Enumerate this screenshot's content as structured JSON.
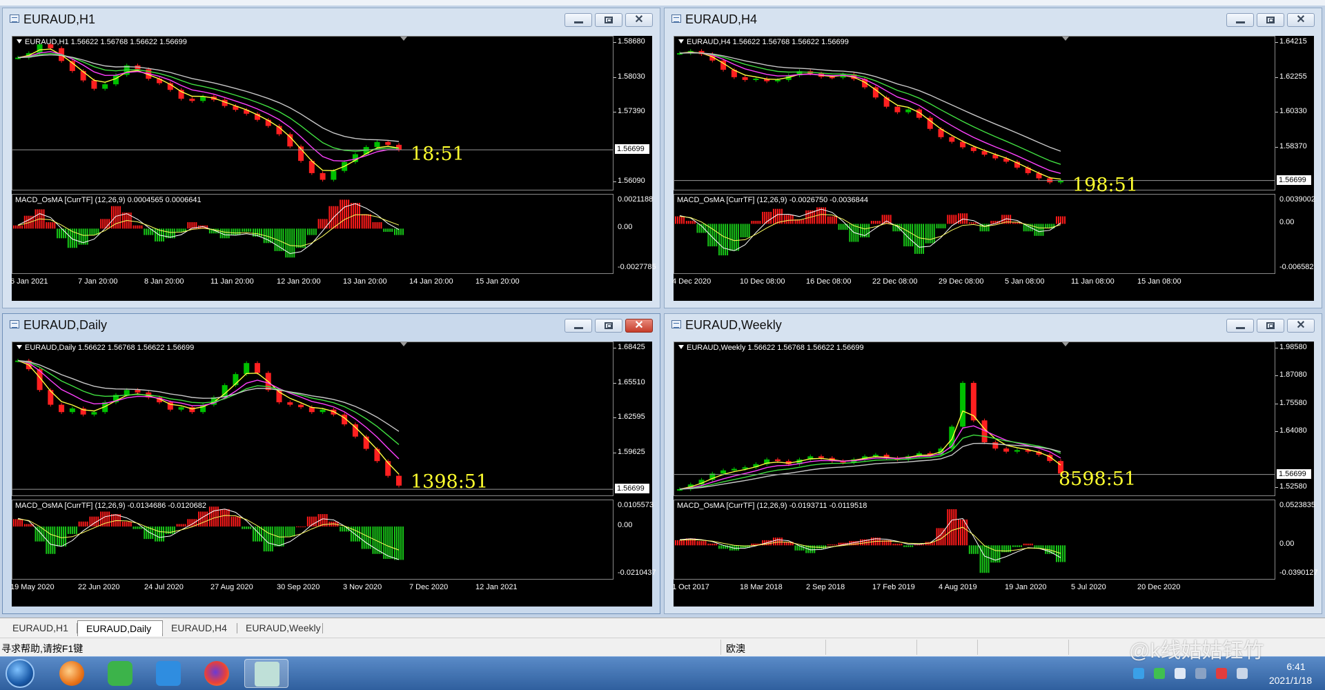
{
  "windows": [
    {
      "id": "h1",
      "title": "EURAUD,H1",
      "active": false,
      "close_red": false,
      "header": "EURAUD,H1  1.56622 1.56768 1.56622 1.56699",
      "macd_header": "MACD_OsMA [CurrTF] (12,26,9) 0.0004565 0.0006641",
      "price_axis": [
        "1.58680",
        "1.58030",
        "1.57390",
        "1.56699",
        "1.56090"
      ],
      "current_price": "1.56699",
      "macd_axis": [
        "0.0021188",
        "0.00",
        "-0.0027785"
      ],
      "timer": "18:51",
      "x_labels": [
        "6 Jan 2021",
        "7 Jan 20:00",
        "8 Jan 20:00",
        "11 Jan 20:00",
        "12 Jan 20:00",
        "13 Jan 20:00",
        "14 Jan 20:00",
        "15 Jan 20:00"
      ],
      "series": [
        1.5836,
        1.5844,
        1.586,
        1.5853,
        1.583,
        1.5812,
        1.5795,
        1.578,
        1.5788,
        1.5805,
        1.5822,
        1.5815,
        1.5798,
        1.579,
        1.5778,
        1.5762,
        1.5758,
        1.5766,
        1.576,
        1.5749,
        1.5742,
        1.5735,
        1.5724,
        1.5713,
        1.5698,
        1.5676,
        1.565,
        1.5628,
        1.5616,
        1.5632,
        1.5648,
        1.5662,
        1.5675,
        1.5684,
        1.5679,
        1.567
      ],
      "osc": [
        0.0002,
        0.0008,
        0.0012,
        0.0004,
        -0.0006,
        -0.0012,
        -0.001,
        -0.0004,
        0.0006,
        0.0014,
        0.001,
        0.0002,
        -0.0004,
        -0.0008,
        -0.0006,
        -0.0002,
        0.0004,
        0.0002,
        -0.0003,
        -0.0006,
        -0.0004,
        -0.0002,
        -0.0005,
        -0.0009,
        -0.0014,
        -0.0018,
        -0.0012,
        -0.0004,
        0.0006,
        0.0014,
        0.0018,
        0.0016,
        0.0009,
        0.0004,
        -0.0002,
        -0.0004
      ],
      "y_range": [
        1.5598,
        1.5874
      ],
      "osc_range": [
        -0.0027785,
        0.0021188
      ]
    },
    {
      "id": "h4",
      "title": "EURAUD,H4",
      "active": false,
      "close_red": false,
      "header": "EURAUD,H4  1.56622 1.56768 1.56622 1.56699",
      "macd_header": "MACD_OsMA [CurrTF] (12,26,9) -0.0026750 -0.0036844",
      "price_axis": [
        "1.64215",
        "1.62255",
        "1.60330",
        "1.58370",
        "1.56699"
      ],
      "current_price": "1.56699",
      "macd_axis": [
        "0.0039002",
        "0.00",
        "-0.006582"
      ],
      "timer": "198:51",
      "x_labels": [
        "4 Dec 2020",
        "10 Dec 08:00",
        "16 Dec 08:00",
        "22 Dec 08:00",
        "29 Dec 08:00",
        "5 Jan 08:00",
        "11 Jan 08:00",
        "15 Jan 08:00"
      ],
      "series": [
        1.636,
        1.6372,
        1.6355,
        1.632,
        1.627,
        1.623,
        1.6215,
        1.6222,
        1.6208,
        1.6215,
        1.624,
        1.6262,
        1.625,
        1.6232,
        1.6228,
        1.6245,
        1.622,
        1.6175,
        1.612,
        1.607,
        1.604,
        1.6055,
        1.601,
        1.595,
        1.5905,
        1.588,
        1.585,
        1.583,
        1.581,
        1.579,
        1.5772,
        1.574,
        1.571,
        1.5682,
        1.566,
        1.567
      ],
      "osc": [
        0.001,
        0.0004,
        -0.0012,
        -0.003,
        -0.0042,
        -0.0036,
        -0.0018,
        0.0004,
        0.0016,
        0.002,
        0.0012,
        0.0006,
        0.0018,
        0.0022,
        0.001,
        -0.0008,
        -0.0024,
        -0.0018,
        0.0004,
        0.0012,
        -0.001,
        -0.003,
        -0.004,
        -0.0026,
        -0.0006,
        0.0012,
        0.0014,
        0.0002,
        -0.001,
        0.0004,
        0.0012,
        0.0002,
        -0.001,
        -0.0016,
        -0.0006,
        0.001
      ],
      "y_range": [
        1.562,
        1.645
      ],
      "osc_range": [
        -0.006582,
        0.0039002
      ]
    },
    {
      "id": "daily",
      "title": "EURAUD,Daily",
      "active": true,
      "close_red": true,
      "header": "EURAUD,Daily  1.56622 1.56768 1.56622 1.56699",
      "macd_header": "MACD_OsMA [CurrTF] (12,26,9) -0.0134686 -0.0120682",
      "price_axis": [
        "1.68425",
        "1.65510",
        "1.62595",
        "1.59625",
        "1.56699"
      ],
      "current_price": "1.56699",
      "macd_axis": [
        "0.0105573",
        "0.00",
        "-0.0210437"
      ],
      "timer": "1398:51",
      "x_labels": [
        "19 May 2020",
        "22 Jun 2020",
        "24 Jul 2020",
        "27 Aug 2020",
        "30 Sep 2020",
        "3 Nov 2020",
        "7 Dec 2020",
        "12 Jan 2021"
      ],
      "series": [
        1.672,
        1.665,
        1.648,
        1.636,
        1.63,
        1.633,
        1.628,
        1.63,
        1.638,
        1.644,
        1.648,
        1.646,
        1.642,
        1.638,
        1.632,
        1.634,
        1.63,
        1.636,
        1.642,
        1.652,
        1.661,
        1.67,
        1.662,
        1.648,
        1.638,
        1.636,
        1.634,
        1.63,
        1.632,
        1.628,
        1.62,
        1.61,
        1.6,
        1.59,
        1.578,
        1.57
      ],
      "osc": [
        0.003,
        0.001,
        -0.006,
        -0.011,
        -0.008,
        -0.003,
        0.002,
        0.004,
        0.006,
        0.005,
        0.002,
        -0.001,
        -0.005,
        -0.006,
        -0.003,
        0.001,
        0.003,
        0.006,
        0.008,
        0.007,
        0.004,
        -0.001,
        -0.006,
        -0.01,
        -0.008,
        -0.004,
        0.0,
        0.004,
        0.005,
        0.002,
        -0.002,
        -0.006,
        -0.009,
        -0.011,
        -0.013,
        -0.0134
      ],
      "y_range": [
        1.562,
        1.687
      ],
      "osc_range": [
        -0.0210437,
        0.0105573
      ]
    },
    {
      "id": "weekly",
      "title": "EURAUD,Weekly",
      "active": false,
      "close_red": false,
      "header": "EURAUD,Weekly  1.56622 1.56768 1.56622 1.56699",
      "macd_header": "MACD_OsMA [CurrTF] (12,26,9) -0.0193711 -0.0119518",
      "price_axis": [
        "1.98580",
        "1.87080",
        "1.75580",
        "1.64080",
        "1.56699",
        "1.52580"
      ],
      "current_price": "1.56699",
      "macd_axis": [
        "0.0523835",
        "0.00",
        "-0.0390127"
      ],
      "timer": "8598:51",
      "x_labels": [
        "1 Oct 2017",
        "18 Mar 2018",
        "2 Sep 2018",
        "17 Feb 2019",
        "4 Aug 2019",
        "19 Jan 2020",
        "5 Jul 2020",
        "20 Dec 2020"
      ],
      "series": [
        1.52,
        1.535,
        1.55,
        1.57,
        1.58,
        1.585,
        1.59,
        1.6,
        1.615,
        1.61,
        1.6,
        1.615,
        1.625,
        1.62,
        1.61,
        1.605,
        1.615,
        1.625,
        1.63,
        1.62,
        1.615,
        1.625,
        1.635,
        1.63,
        1.65,
        1.72,
        1.86,
        1.74,
        1.67,
        1.65,
        1.64,
        1.645,
        1.64,
        1.63,
        1.61,
        1.57
      ],
      "osc": [
        0.006,
        0.008,
        0.005,
        0.002,
        -0.004,
        -0.006,
        -0.003,
        0.002,
        0.006,
        0.009,
        0.004,
        -0.006,
        -0.009,
        -0.004,
        0.001,
        0.003,
        0.005,
        0.007,
        0.009,
        0.006,
        0.002,
        -0.002,
        0.001,
        0.004,
        0.02,
        0.042,
        0.03,
        -0.01,
        -0.032,
        -0.02,
        -0.008,
        -0.002,
        0.002,
        -0.004,
        -0.01,
        -0.0194
      ],
      "y_range": [
        1.5,
        1.99
      ],
      "osc_range": [
        -0.0390127,
        0.0523835
      ]
    }
  ],
  "tabs": [
    "EURAUD,H1",
    "EURAUD,Daily",
    "EURAUD,H4",
    "EURAUD,Weekly"
  ],
  "active_tab": "EURAUD,Daily",
  "status": {
    "help": "寻求帮助,请按F1键",
    "region": "欧澳"
  },
  "taskbar": {
    "apps": [
      "start-orb",
      "music-app-icon",
      "wechat-icon",
      "notes-app-icon",
      "firefox-icon",
      "metatrader-icon"
    ],
    "time": "6:41",
    "date": "2021/1/18"
  },
  "watermark": "@k线姑姑钰竹",
  "colors": {
    "bull": "#00c000",
    "bear": "#ff2020",
    "ma_fast": "#ffff40",
    "ma_mid": "#ff40ff",
    "ma_slow": "#40e040",
    "ma_long": "#c8c8c8",
    "macd_up": "#ff1a1a",
    "macd_down": "#18c818",
    "timer": "#ffff2e"
  }
}
